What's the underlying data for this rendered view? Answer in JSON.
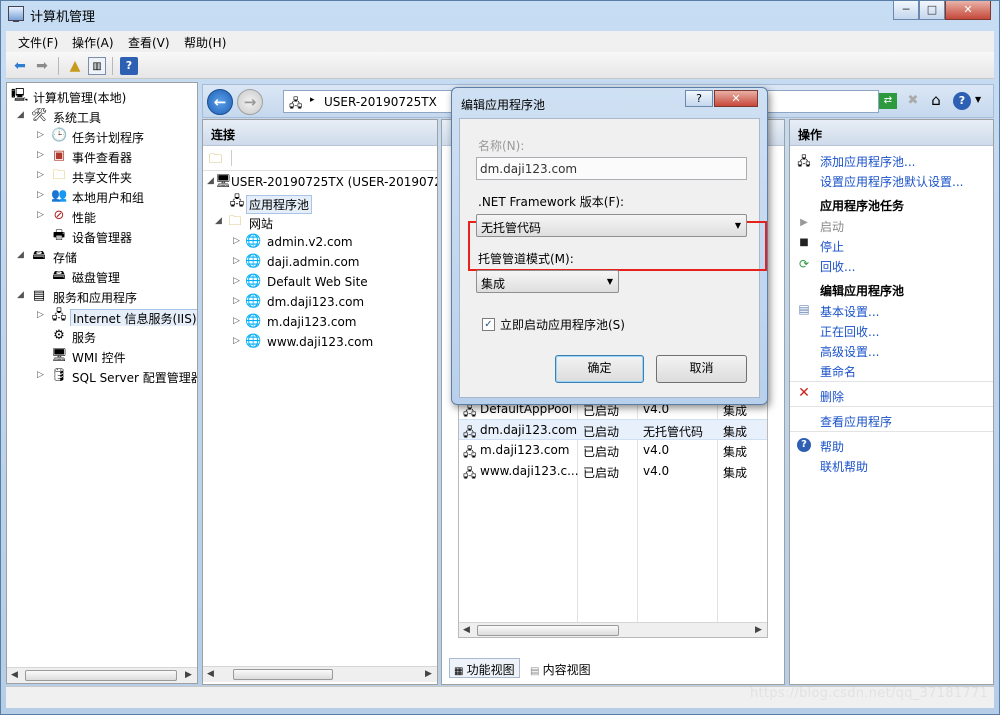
{
  "window": {
    "title": "计算机管理",
    "minimize": "─",
    "maximize": "□",
    "close": "✕"
  },
  "menu": {
    "file": "文件(F)",
    "action": "操作(A)",
    "view": "查看(V)",
    "help": "帮助(H)"
  },
  "tree": {
    "root": "计算机管理(本地)",
    "system_tools": "系统工具",
    "task_scheduler": "任务计划程序",
    "event_viewer": "事件查看器",
    "shared_folders": "共享文件夹",
    "local_users": "本地用户和组",
    "performance": "性能",
    "device_manager": "设备管理器",
    "storage": "存储",
    "disk_management": "磁盘管理",
    "services_apps": "服务和应用程序",
    "iis": "Internet 信息服务(IIS)管",
    "services": "服务",
    "wmi": "WMI 控件",
    "sql": "SQL Server 配置管理器"
  },
  "breadcrumb": {
    "server": "USER-20190725TX",
    "sep": "▸"
  },
  "connections": {
    "header": "连接",
    "server": "USER-20190725TX (USER-20190725",
    "app_pools": "应用程序池",
    "sites": "网站",
    "site_list": [
      "admin.v2.com",
      "daji.admin.com",
      "Default Web Site",
      "dm.daji123.com",
      "m.daji123.com",
      "www.daji123.com"
    ]
  },
  "app_pools": {
    "rows": [
      {
        "name": "DefaultAppPool",
        "status": "已启动",
        "clr": "v4.0",
        "pipeline": "集成"
      },
      {
        "name": "dm.daji123.com",
        "status": "已启动",
        "clr": "无托管代码",
        "pipeline": "集成"
      },
      {
        "name": "m.daji123.com",
        "status": "已启动",
        "clr": "v4.0",
        "pipeline": "集成"
      },
      {
        "name": "www.daji123.c...",
        "status": "已启动",
        "clr": "v4.0",
        "pipeline": "集成"
      }
    ]
  },
  "view_tabs": {
    "features": "功能视图",
    "content": "内容视图"
  },
  "actions": {
    "header": "操作",
    "add_pool": "添加应用程序池...",
    "set_defaults": "设置应用程序池默认设置...",
    "tasks_header": "应用程序池任务",
    "start": "启动",
    "stop": "停止",
    "recycle": "回收...",
    "edit_header": "编辑应用程序池",
    "basic": "基本设置...",
    "recycling": "正在回收...",
    "advanced": "高级设置...",
    "rename": "重命名",
    "delete": "删除",
    "view_apps": "查看应用程序",
    "help": "帮助",
    "online_help": "联机帮助"
  },
  "dialog": {
    "title": "编辑应用程序池",
    "help_btn": "?",
    "close_btn": "✕",
    "name_label": "名称(N):",
    "name_value": "dm.daji123.com",
    "framework_label": ".NET Framework 版本(F):",
    "framework_value": "无托管代码",
    "pipeline_label": "托管管道模式(M):",
    "pipeline_value": "集成",
    "autostart_label": "立即启动应用程序池(S)",
    "autostart_checked": "✓",
    "ok": "确定",
    "cancel": "取消"
  },
  "watermark": "https://blog.csdn.net/qq_37181771",
  "colors": {
    "highlight_box": "#e8221a",
    "link": "#1a52c9"
  }
}
